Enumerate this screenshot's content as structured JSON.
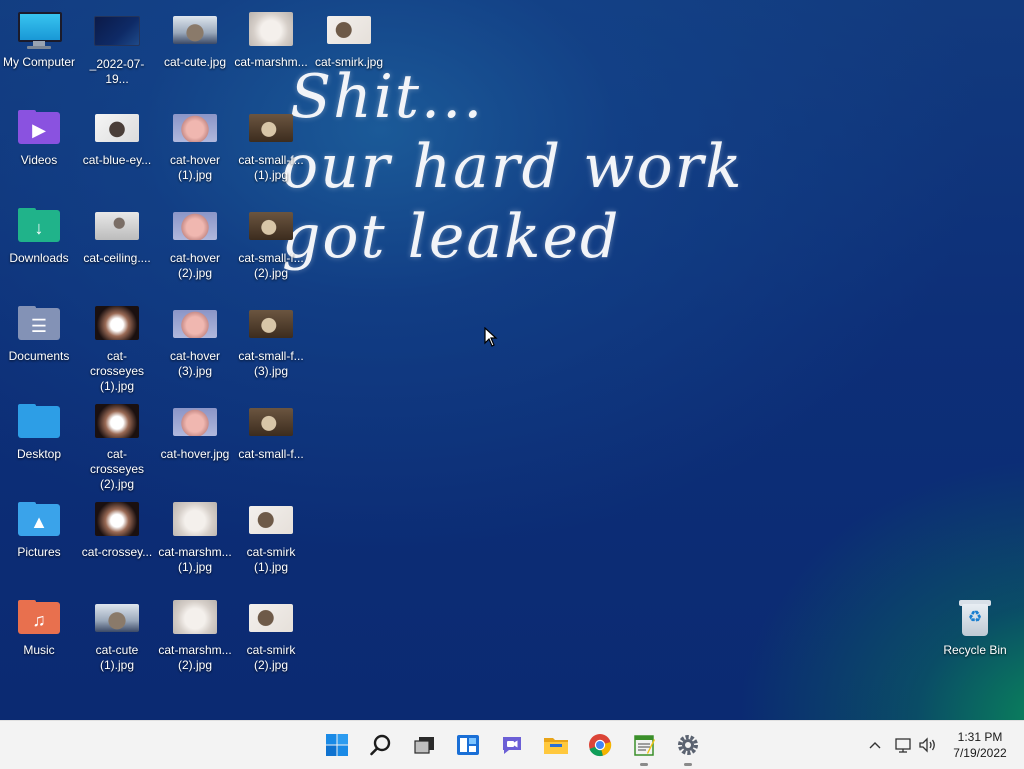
{
  "wallpaper": {
    "lines": [
      "Shit...",
      "our hard work",
      "got leaked"
    ]
  },
  "desktop_icons": {
    "system": [
      {
        "label": "My Computer",
        "icon": "computer-icon"
      },
      {
        "label": "Videos",
        "icon": "videos-folder-icon"
      },
      {
        "label": "Downloads",
        "icon": "downloads-folder-icon"
      },
      {
        "label": "Documents",
        "icon": "documents-folder-icon"
      },
      {
        "label": "Desktop",
        "icon": "desktop-folder-icon"
      },
      {
        "label": "Pictures",
        "icon": "pictures-folder-icon"
      },
      {
        "label": "Music",
        "icon": "music-folder-icon"
      }
    ],
    "files": [
      {
        "label": "_2022-07-19..."
      },
      {
        "label": "cat-cute.jpg"
      },
      {
        "label": "cat-marshm..."
      },
      {
        "label": "cat-smirk.jpg"
      },
      {
        "label": "cat-blue-ey..."
      },
      {
        "label": "cat-hover (1).jpg"
      },
      {
        "label": "cat-small-f... (1).jpg"
      },
      {
        "label": "cat-ceiling...."
      },
      {
        "label": "cat-hover (2).jpg"
      },
      {
        "label": "cat-small-f... (2).jpg"
      },
      {
        "label": "cat-crosseyes (1).jpg"
      },
      {
        "label": "cat-hover (3).jpg"
      },
      {
        "label": "cat-small-f... (3).jpg"
      },
      {
        "label": "cat-crosseyes (2).jpg"
      },
      {
        "label": "cat-hover.jpg"
      },
      {
        "label": "cat-small-f..."
      },
      {
        "label": "cat-crossey..."
      },
      {
        "label": "cat-marshm... (1).jpg"
      },
      {
        "label": "cat-smirk (1).jpg"
      },
      {
        "label": "cat-cute (1).jpg"
      },
      {
        "label": "cat-marshm... (2).jpg"
      },
      {
        "label": "cat-smirk (2).jpg"
      }
    ],
    "recycle_bin": {
      "label": "Recycle Bin",
      "icon": "recycle-bin-icon"
    }
  },
  "taskbar": {
    "apps": [
      "start-icon",
      "search-icon",
      "task-view-icon",
      "widgets-icon",
      "chat-icon",
      "file-explorer-icon",
      "chrome-icon",
      "notepad-icon",
      "settings-icon"
    ],
    "tray": {
      "clock_time": "1:31 PM",
      "clock_date": "7/19/2022"
    }
  },
  "colors": {
    "desktop_bg": "#0d2f78",
    "taskbar_bg": "#f3f3f3",
    "accent": "#0067c0"
  }
}
